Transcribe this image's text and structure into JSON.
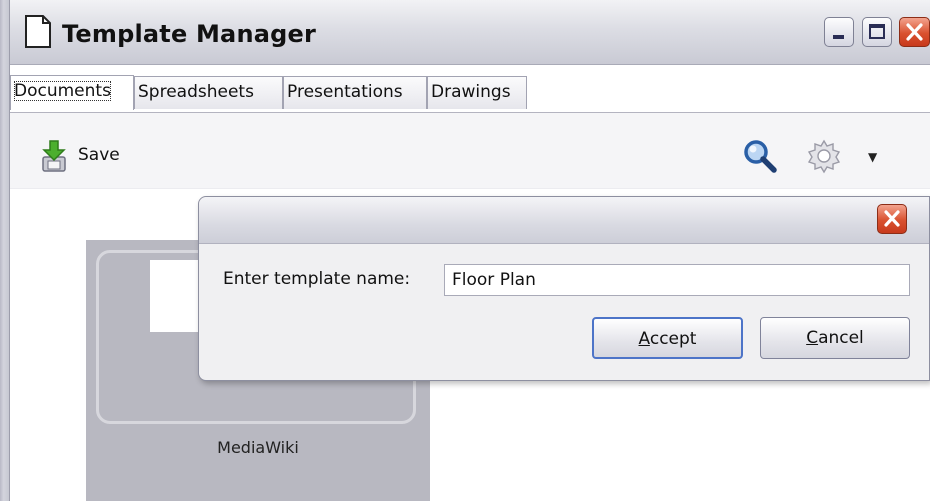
{
  "window": {
    "title": "Template Manager",
    "title_icon": "document-icon",
    "controls": [
      "minimize-icon",
      "maximize-icon",
      "close-icon"
    ]
  },
  "tabs": [
    {
      "label": "Documents",
      "active": true
    },
    {
      "label": "Spreadsheets",
      "active": false
    },
    {
      "label": "Presentations",
      "active": false
    },
    {
      "label": "Drawings",
      "active": false
    }
  ],
  "toolbar": {
    "save_label": "Save",
    "save_icon": "save-arrow-icon",
    "search_icon": "search-icon",
    "settings_icon": "gear-icon",
    "settings_dropdown_icon": "chevron-down-icon"
  },
  "templates": [
    {
      "label": "MediaWiki"
    }
  ],
  "dialog": {
    "prompt_label": "Enter template name:",
    "input_value": "Floor Plan",
    "accept_label": "Accept",
    "accept_mnemonic": "A",
    "cancel_label": "Cancel",
    "cancel_mnemonic": "C"
  },
  "colors": {
    "close_button": "#d9512f",
    "default_button_border": "#4d74c8",
    "tile_background": "#b8b8c1"
  }
}
